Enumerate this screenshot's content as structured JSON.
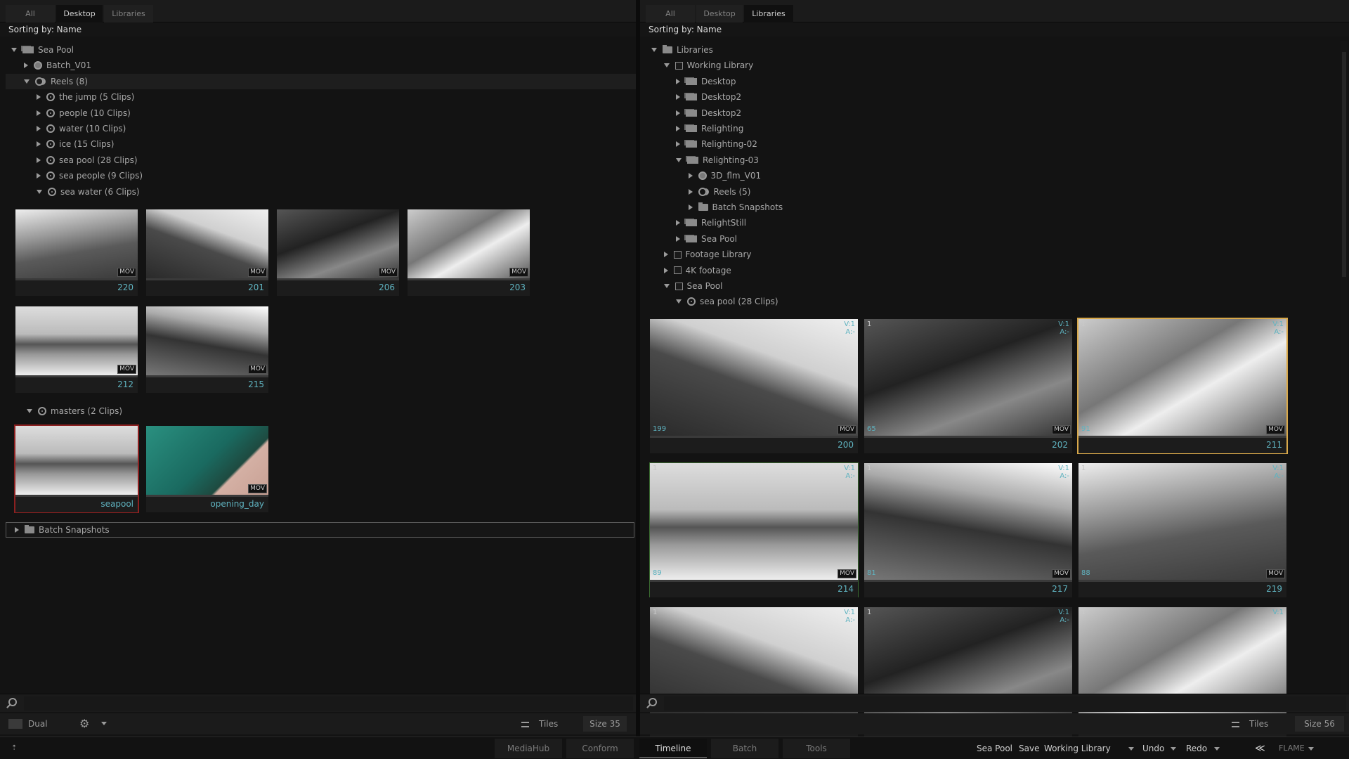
{
  "left": {
    "tabs": [
      "All",
      "Desktop",
      "Libraries"
    ],
    "active_tab": 1,
    "sorting": "Sorting by: Name",
    "tree": [
      {
        "label": "Sea Pool",
        "level": 0,
        "expanded": true,
        "icon": "folders-icon"
      },
      {
        "label": "Batch_V01",
        "level": 1,
        "expanded": false,
        "icon": "batch-icon"
      },
      {
        "label": "Reels (8)",
        "level": 1,
        "expanded": true,
        "icon": "reels-icon"
      },
      {
        "label": "the jump (5 Clips)",
        "level": 2,
        "expanded": false,
        "icon": "reel-icon"
      },
      {
        "label": "people (10 Clips)",
        "level": 2,
        "expanded": false,
        "icon": "reel-icon"
      },
      {
        "label": "water (10 Clips)",
        "level": 2,
        "expanded": false,
        "icon": "reel-icon"
      },
      {
        "label": "ice (15 Clips)",
        "level": 2,
        "expanded": false,
        "icon": "reel-icon"
      },
      {
        "label": "sea pool (28 Clips)",
        "level": 2,
        "expanded": false,
        "icon": "reel-icon"
      },
      {
        "label": "sea people (9 Clips)",
        "level": 2,
        "expanded": false,
        "icon": "reel-icon"
      },
      {
        "label": "sea water (6 Clips)",
        "level": 2,
        "expanded": true,
        "icon": "reel-icon"
      }
    ],
    "sea_water_clips": [
      {
        "name": "220",
        "badge": "MOV"
      },
      {
        "name": "201",
        "badge": "MOV"
      },
      {
        "name": "206",
        "badge": "MOV"
      },
      {
        "name": "203",
        "badge": "MOV"
      },
      {
        "name": "212",
        "badge": "MOV"
      },
      {
        "name": "215",
        "badge": "MOV"
      }
    ],
    "masters_label": "masters (2 Clips)",
    "masters_clips": [
      {
        "name": "seapool",
        "badge": ""
      },
      {
        "name": "opening_day",
        "badge": "MOV"
      }
    ],
    "batch_snapshots": "Batch Snapshots",
    "footer": {
      "dual": "Dual",
      "tiles": "Tiles",
      "size": "Size 35"
    }
  },
  "right": {
    "tabs": [
      "All",
      "Desktop",
      "Libraries"
    ],
    "active_tab": 2,
    "sorting": "Sorting by: Name",
    "tree": [
      {
        "label": "Libraries",
        "level": 0,
        "expanded": true,
        "icon": "folder-icon"
      },
      {
        "label": "Working Library",
        "level": 1,
        "expanded": true,
        "icon": "lib-icon"
      },
      {
        "label": "Desktop",
        "level": 2,
        "expanded": false,
        "icon": "folders-icon"
      },
      {
        "label": "Desktop2",
        "level": 2,
        "expanded": false,
        "icon": "folders-icon"
      },
      {
        "label": "Desktop2",
        "level": 2,
        "expanded": false,
        "icon": "folders-icon"
      },
      {
        "label": "Relighting",
        "level": 2,
        "expanded": false,
        "icon": "folders-icon"
      },
      {
        "label": "Relighting-02",
        "level": 2,
        "expanded": false,
        "icon": "folders-icon"
      },
      {
        "label": "Relighting-03",
        "level": 2,
        "expanded": true,
        "icon": "folders-icon"
      },
      {
        "label": "3D_flm_V01",
        "level": 3,
        "expanded": false,
        "icon": "batch-icon"
      },
      {
        "label": "Reels (5)",
        "level": 3,
        "expanded": false,
        "icon": "reels-icon"
      },
      {
        "label": "Batch Snapshots",
        "level": 3,
        "expanded": false,
        "icon": "folder-icon"
      },
      {
        "label": "RelightStill",
        "level": 2,
        "expanded": false,
        "icon": "folders-icon"
      },
      {
        "label": "Sea Pool",
        "level": 2,
        "expanded": false,
        "icon": "folders-icon"
      },
      {
        "label": "Footage Library",
        "level": 1,
        "expanded": false,
        "icon": "lib-icon"
      },
      {
        "label": "4K footage",
        "level": 1,
        "expanded": false,
        "icon": "lib-icon"
      },
      {
        "label": "Sea Pool",
        "level": 1,
        "expanded": true,
        "icon": "lib-icon"
      },
      {
        "label": "sea pool (28 Clips)",
        "level": 2,
        "expanded": true,
        "icon": "reel-icon"
      }
    ],
    "clips": [
      {
        "name": "200",
        "tl": "",
        "tr": "V:1\nA:-",
        "bl": "199",
        "badge": "MOV"
      },
      {
        "name": "202",
        "tl": "1",
        "tr": "V:1\nA:-",
        "bl": "65",
        "badge": "MOV"
      },
      {
        "name": "211",
        "tl": "1",
        "tr": "V:1\nA:-",
        "bl": "91",
        "badge": "MOV"
      },
      {
        "name": "214",
        "tl": "1",
        "tr": "V:1\nA:-",
        "bl": "89",
        "badge": "MOV"
      },
      {
        "name": "217",
        "tl": "1",
        "tr": "V:1\nA:-",
        "bl": "81",
        "badge": "MOV"
      },
      {
        "name": "219",
        "tl": "1",
        "tr": "V:1\nA:-",
        "bl": "88",
        "badge": "MOV"
      },
      {
        "name": "",
        "tl": "1",
        "tr": "V:1\nA:-",
        "bl": "",
        "badge": ""
      },
      {
        "name": "",
        "tl": "1",
        "tr": "V:1\nA:-",
        "bl": "",
        "badge": ""
      },
      {
        "name": "",
        "tl": "1",
        "tr": "V:1",
        "bl": "",
        "badge": ""
      }
    ],
    "footer": {
      "tiles": "Tiles",
      "size": "Size 56"
    }
  },
  "bottom": {
    "tabs": [
      "MediaHub",
      "Conform",
      "Timeline",
      "Batch",
      "Tools"
    ],
    "active_tab": 2,
    "context": "Sea Pool",
    "save": "Save",
    "library": "Working Library",
    "undo": "Undo",
    "redo": "Redo",
    "logo": "FLAME"
  }
}
